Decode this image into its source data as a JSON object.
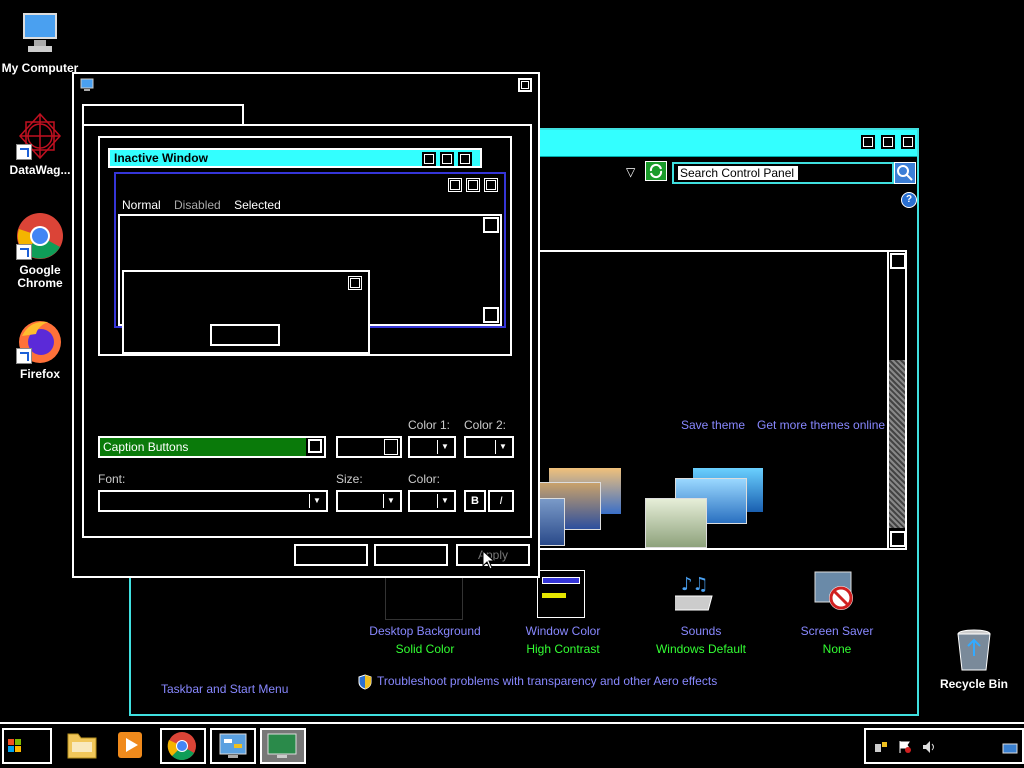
{
  "desktop": {
    "icons": [
      {
        "label": "My Computer"
      },
      {
        "label": "DataWag..."
      },
      {
        "label": "Google Chrome"
      },
      {
        "label": "Firefox"
      },
      {
        "label": "Recycle Bin"
      }
    ]
  },
  "control_panel": {
    "search_value": "Search Control Panel",
    "help": "?",
    "links": {
      "save_theme": "Save theme",
      "more_themes": "Get more themes online",
      "taskbar": "Taskbar and Start Menu",
      "troubleshoot": "Troubleshoot problems with transparency and other Aero effects"
    },
    "bottom_items": [
      {
        "title": "Desktop Background",
        "value": "Solid Color"
      },
      {
        "title": "Window Color",
        "value": "High Contrast"
      },
      {
        "title": "Sounds",
        "value": "Windows Default"
      },
      {
        "title": "Screen Saver",
        "value": "None"
      }
    ]
  },
  "appearance_dialog": {
    "preview": {
      "inactive_title": "Inactive Window",
      "menu_normal": "Normal",
      "menu_disabled": "Disabled",
      "menu_selected": "Selected"
    },
    "item_label": "Caption Buttons",
    "labels": {
      "color1": "Color 1:",
      "color2": "Color 2:",
      "font": "Font:",
      "size": "Size:",
      "color": "Color:",
      "bold": "B",
      "italic": "I"
    },
    "buttons": {
      "ok": "",
      "cancel": "",
      "apply": "Apply"
    }
  }
}
